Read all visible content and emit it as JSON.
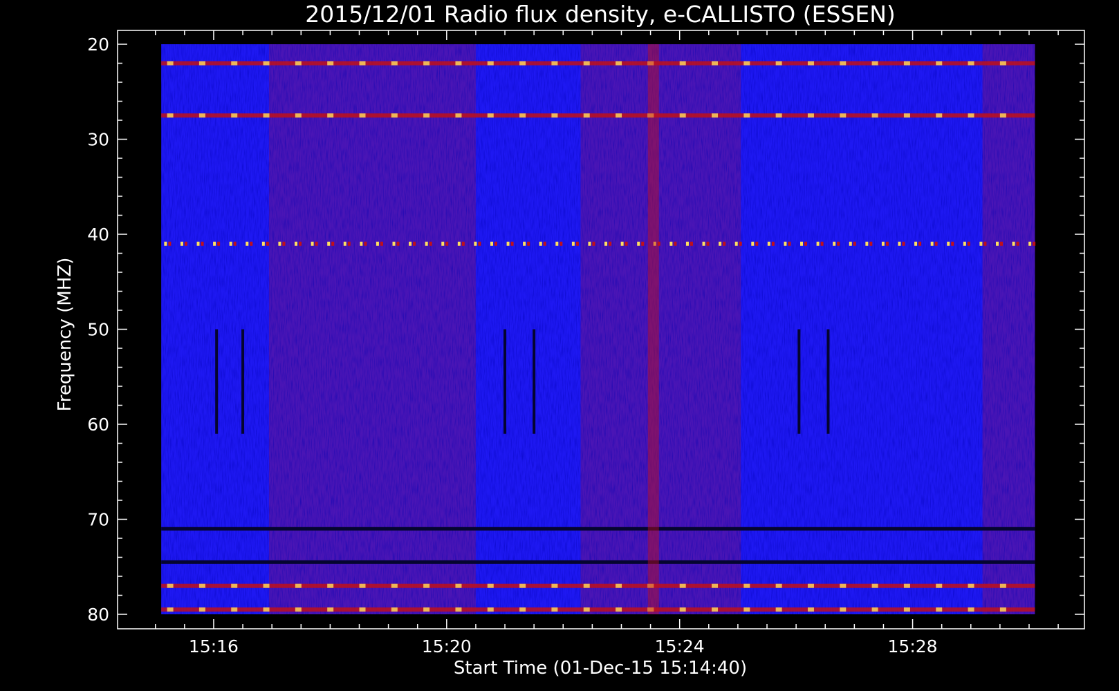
{
  "chart_data": {
    "type": "heatmap",
    "title": "2015/12/01  Radio flux density, e-CALLISTO (ESSEN)",
    "xlabel": "Start Time (01-Dec-15 15:14:40)",
    "ylabel": "Frequency (MHZ)",
    "x_range_minutes_after_15_00": [
      14.35,
      30.95
    ],
    "x_data_extent_minutes_after_15_00": [
      15.1,
      30.1
    ],
    "x_ticks": [
      {
        "minute": 16,
        "label": "15:16"
      },
      {
        "minute": 20,
        "label": "15:20"
      },
      {
        "minute": 24,
        "label": "15:24"
      },
      {
        "minute": 28,
        "label": "15:28"
      }
    ],
    "y_range_mhz": [
      80,
      20
    ],
    "y_data_extent_mhz": [
      20,
      80
    ],
    "y_ticks": [
      20,
      30,
      40,
      50,
      60,
      70,
      80
    ],
    "colormap": "blue-red-yellow",
    "colors": {
      "background": "#000000",
      "low": "#1e18f2",
      "mid": "#c0101a",
      "high": "#ffe060",
      "dark": "#050530"
    },
    "features": [
      {
        "kind": "horizontal-band",
        "freq_mhz": 22,
        "intensity": "high",
        "note": "intermittent bright line across most of time"
      },
      {
        "kind": "horizontal-band",
        "freq_mhz": 27.5,
        "intensity": "high"
      },
      {
        "kind": "horizontal-band",
        "freq_mhz": 41,
        "intensity": "high",
        "note": "periodic dots"
      },
      {
        "kind": "horizontal-band",
        "freq_mhz": 71,
        "intensity": "dark"
      },
      {
        "kind": "horizontal-band",
        "freq_mhz": 74.5,
        "intensity": "dark"
      },
      {
        "kind": "horizontal-band",
        "freq_mhz": 77,
        "intensity": "high"
      },
      {
        "kind": "horizontal-band",
        "freq_mhz": 79.5,
        "intensity": "high"
      },
      {
        "kind": "vertical-band",
        "time_minute": 23.55,
        "intensity": "high",
        "note": "broadband interference"
      },
      {
        "kind": "vertical-dark-lines",
        "time_minutes": [
          16.05,
          16.5,
          21.0,
          21.5,
          26.05,
          26.55
        ],
        "freq_range_mhz": [
          50,
          61
        ]
      }
    ],
    "segments": [
      {
        "start_minute": 15.1,
        "end_minute": 16.95,
        "level": "blue"
      },
      {
        "start_minute": 16.95,
        "end_minute": 20.5,
        "level": "blue-red"
      },
      {
        "start_minute": 20.5,
        "end_minute": 22.3,
        "level": "blue"
      },
      {
        "start_minute": 22.3,
        "end_minute": 25.05,
        "level": "blue-red"
      },
      {
        "start_minute": 25.05,
        "end_minute": 29.2,
        "level": "blue"
      },
      {
        "start_minute": 29.2,
        "end_minute": 30.1,
        "level": "blue-red"
      }
    ]
  }
}
